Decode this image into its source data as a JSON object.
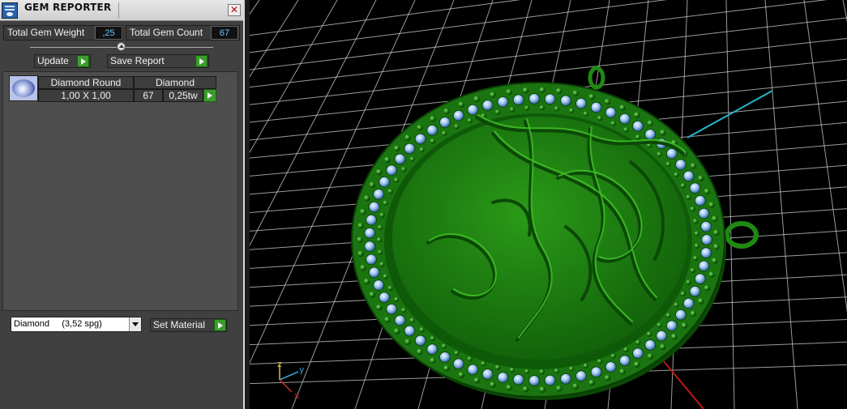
{
  "panel": {
    "title": "GEM REPORTER",
    "close_glyph": "✕",
    "total_weight_label": "Total Gem Weight",
    "total_weight_value": ",25",
    "total_count_label": "Total Gem Count",
    "total_count_value": "67",
    "update_label": "Update",
    "save_report_label": "Save Report",
    "gems": [
      {
        "name": "Diamond Round",
        "material": "Diamond",
        "size": "1,00 X 1,00",
        "count": "67",
        "weight": "0,25tw"
      }
    ],
    "material_select": "Diamond     (3,52 spg)",
    "set_material_label": "Set Material"
  },
  "viewport": {
    "axis_labels": {
      "z": "z",
      "y": "y",
      "x": "x"
    },
    "model_color": "#1f7a12",
    "stone_color": "#9cc3f2",
    "grid_color": "#ffffff"
  },
  "icons": {
    "app": "gem-reporter-app-icon",
    "close": "close-icon",
    "go": "play-arrow-icon",
    "dropdown": "chevron-down-icon"
  }
}
